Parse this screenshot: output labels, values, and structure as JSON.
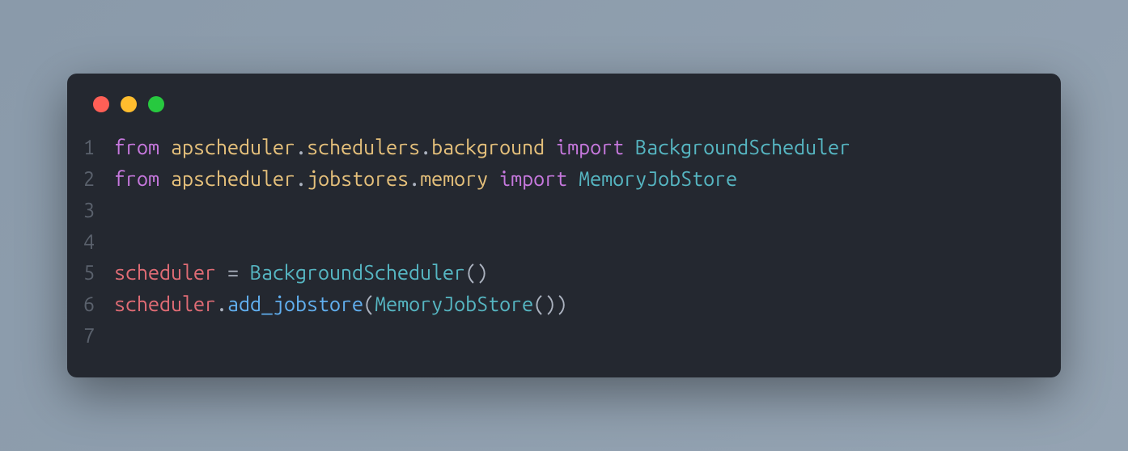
{
  "window": {
    "traffic_lights": {
      "red": "#ff5f56",
      "yellow": "#ffbd2e",
      "green": "#27c93f"
    }
  },
  "code": {
    "line_numbers": [
      "1",
      "2",
      "3",
      "4",
      "5",
      "6",
      "7"
    ],
    "l1": {
      "kw_from": "from",
      "m1": "apscheduler",
      "dot1": ".",
      "m2": "schedulers",
      "dot2": ".",
      "m3": "background",
      "kw_import": "import",
      "cls": "BackgroundScheduler"
    },
    "l2": {
      "kw_from": "from",
      "m1": "apscheduler",
      "dot1": ".",
      "m2": "jobstores",
      "dot2": ".",
      "m3": "memory",
      "kw_import": "import",
      "cls": "MemoryJobStore"
    },
    "l5": {
      "ident": "scheduler",
      "assign": " = ",
      "cls": "BackgroundScheduler",
      "paren": "()"
    },
    "l6": {
      "ident": "scheduler",
      "dot": ".",
      "fn": "add_jobstore",
      "lparen": "(",
      "cls": "MemoryJobStore",
      "paren2": "()",
      "rparen": ")"
    }
  }
}
